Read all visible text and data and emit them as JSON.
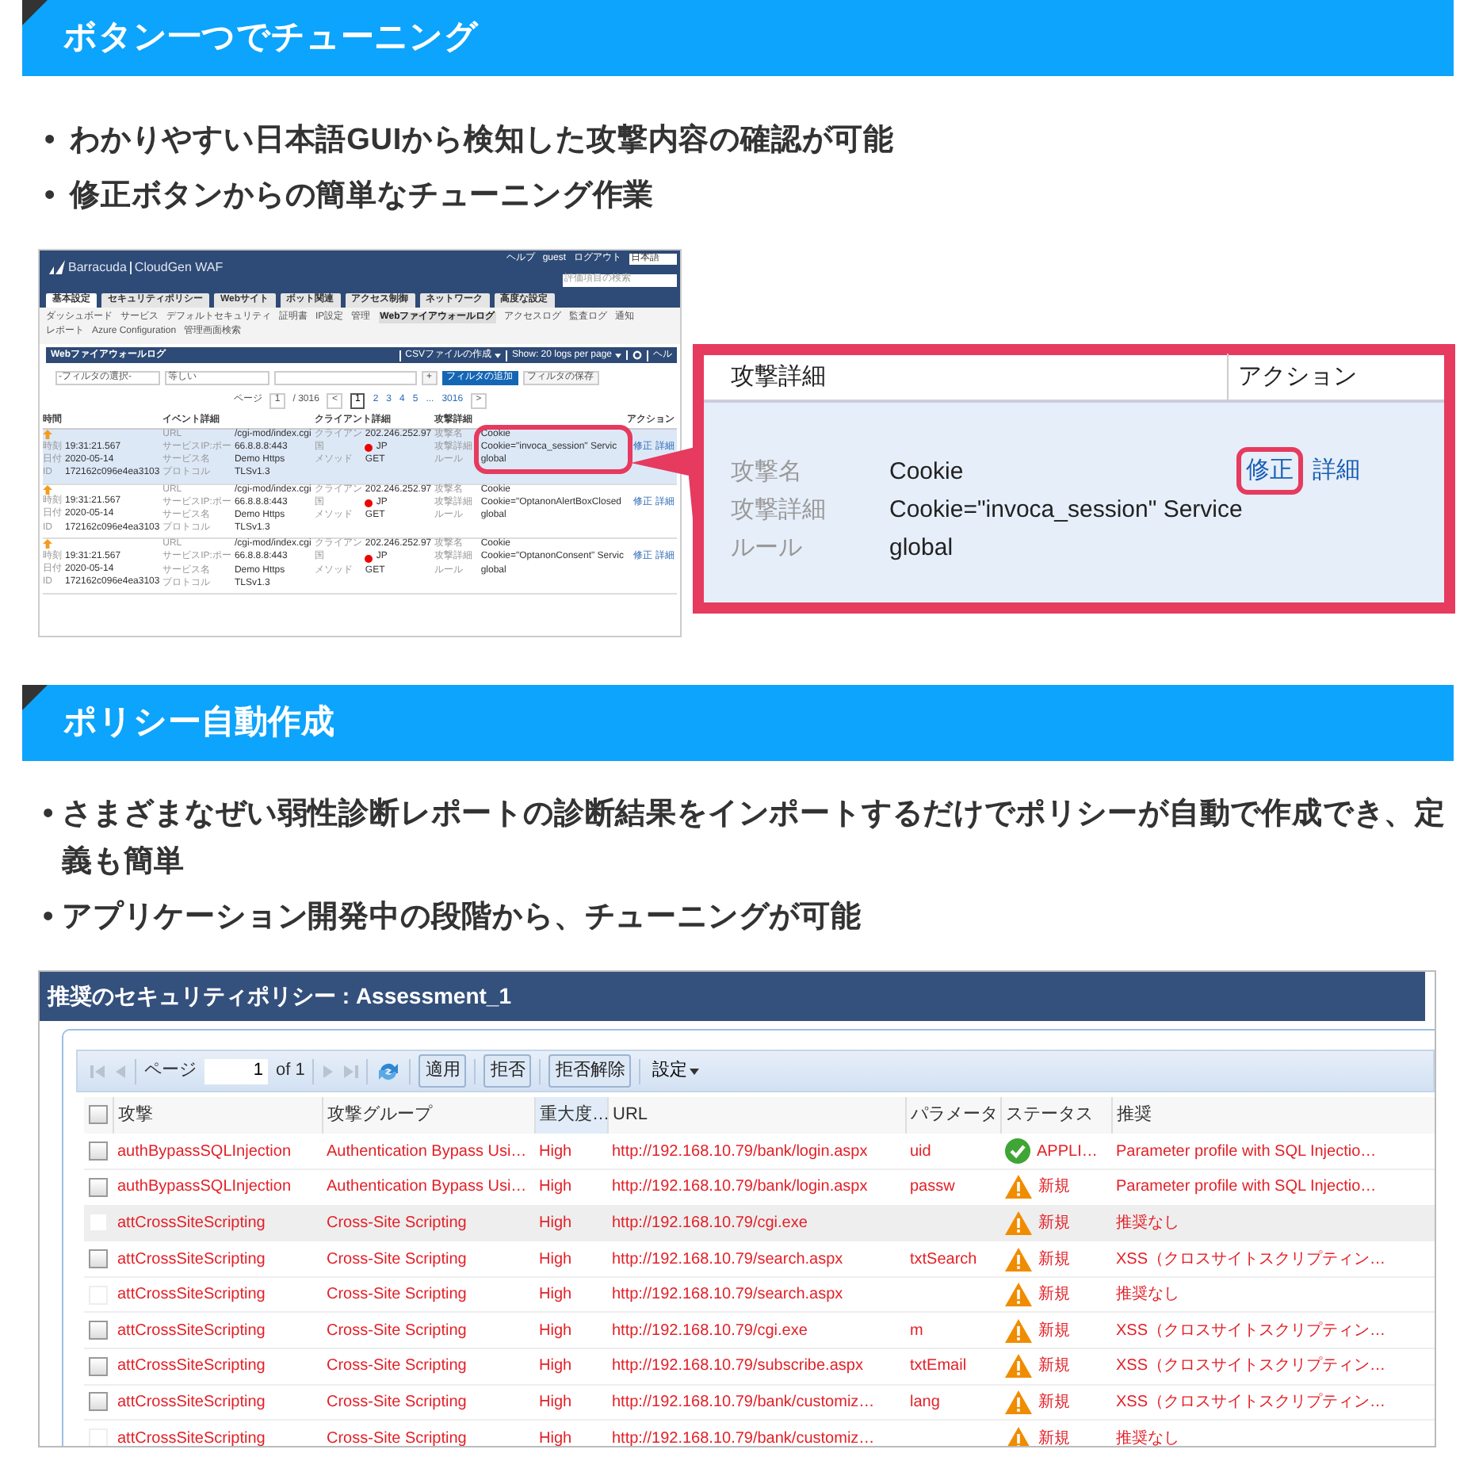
{
  "tuning_section": {
    "title": "ボタン一つでチューニング",
    "bullets": [
      {
        "bullet": "•",
        "text": "わかりやすい日本語GUIから検知した攻撃内容の確認が可能"
      },
      {
        "bullet": "•",
        "text": "修正ボタンからの簡単なチューニング作業"
      }
    ],
    "waf_screenshot": {
      "brand": "Barracuda",
      "product": "CloudGen WAF",
      "help": "ヘルプ",
      "user": "guest",
      "logout": "ログアウト",
      "language": "日本語",
      "search_placeholder": "評価項目の検索",
      "tabs": [
        {
          "label": "基本設定",
          "selected": true
        },
        {
          "label": "セキュリティポリシー",
          "selected": false
        },
        {
          "label": "Webサイト",
          "selected": false
        },
        {
          "label": "ボット関連",
          "selected": false
        },
        {
          "label": "アクセス制御",
          "selected": false
        },
        {
          "label": "ネットワーク",
          "selected": false
        },
        {
          "label": "高度な設定",
          "selected": false
        }
      ],
      "subnav_rows": [
        [
          {
            "label": "ダッシュボード",
            "selected": false
          },
          {
            "label": "サービス",
            "selected": false
          },
          {
            "label": "デフォルトセキュリティ",
            "selected": false
          },
          {
            "label": "証明書",
            "selected": false
          },
          {
            "label": "IP設定",
            "selected": false
          },
          {
            "label": "管理",
            "selected": false
          },
          {
            "label": "Webファイアウォールログ",
            "selected": true
          },
          {
            "label": "アクセスログ",
            "selected": false
          },
          {
            "label": "監査ログ",
            "selected": false
          },
          {
            "label": "通知",
            "selected": false
          }
        ],
        [
          {
            "label": "レポート",
            "selected": false
          },
          {
            "label": "Azure Configuration",
            "selected": false
          },
          {
            "label": "管理画面検索",
            "selected": false
          }
        ]
      ],
      "panel_title": "Webファイアウォールログ",
      "csv_button": "CSVファイルの作成",
      "page_size": "Show: 20 logs per page",
      "help_cut": "ヘル",
      "filter_field": "-フィルタの選択-",
      "operator": "等しい",
      "add_symbol": "+",
      "add_filter": "フィルタの追加",
      "save_filter": "フィルタの保存",
      "pagination": {
        "label": "ページ",
        "page": "1",
        "total": "/ 3016",
        "prev": "<",
        "next": ">",
        "pages": [
          {
            "label": "1",
            "selected": true
          },
          {
            "label": "2",
            "selected": false
          },
          {
            "label": "3",
            "selected": false
          },
          {
            "label": "4",
            "selected": false
          },
          {
            "label": "5",
            "selected": false
          },
          {
            "label": "...",
            "selected": false
          },
          {
            "label": "3016",
            "selected": false
          }
        ]
      },
      "columns": [
        "時間",
        "イベント詳細",
        "クライアント詳細",
        "攻撃詳細",
        "",
        "アクション"
      ],
      "rows": [
        {
          "selected": true,
          "time": [
            {
              "label": "時刻",
              "value": "19:31:21.567"
            },
            {
              "label": "日付",
              "value": "2020-05-14"
            },
            {
              "label": "ID",
              "value": "172162c096e4ea3103"
            }
          ],
          "event": [
            {
              "label": "URL",
              "value": "/cgi-mod/index.cgi"
            },
            {
              "label": "サービスIP:ポー",
              "value": "66.8.8.8:443"
            },
            {
              "label": "サービス名",
              "value": "Demo Https"
            },
            {
              "label": "プロトコル",
              "value": "TLSv1.3"
            }
          ],
          "client": [
            {
              "label": "クライアン",
              "value": "202.246.252.97"
            },
            {
              "label": "国",
              "value": "JP"
            },
            {
              "label": "メソッド",
              "value": "GET"
            }
          ],
          "attack": [
            {
              "label": "攻撃名",
              "value": "Cookie"
            },
            {
              "label": "攻撃詳細",
              "value": "Cookie=\"invoca_session\" Servic"
            },
            {
              "label": "ルール",
              "value": "global"
            }
          ],
          "fix": "修正",
          "details": "詳細"
        },
        {
          "selected": false,
          "time": [
            {
              "label": "時刻",
              "value": "19:31:21.567"
            },
            {
              "label": "日付",
              "value": "2020-05-14"
            },
            {
              "label": "ID",
              "value": "172162c096e4ea3103"
            }
          ],
          "event": [
            {
              "label": "URL",
              "value": "/cgi-mod/index.cgi"
            },
            {
              "label": "サービスIP:ポー",
              "value": "66.8.8.8:443"
            },
            {
              "label": "サービス名",
              "value": "Demo Https"
            },
            {
              "label": "プロトコル",
              "value": "TLSv1.3"
            }
          ],
          "client": [
            {
              "label": "クライアン",
              "value": "202.246.252.97"
            },
            {
              "label": "国",
              "value": "JP"
            },
            {
              "label": "メソッド",
              "value": "GET"
            }
          ],
          "attack": [
            {
              "label": "攻撃名",
              "value": "Cookie"
            },
            {
              "label": "攻撃詳細",
              "value": "Cookie=\"OptanonAlertBoxClosed"
            },
            {
              "label": "ルール",
              "value": "global"
            }
          ],
          "fix": "修正",
          "details": "詳細"
        },
        {
          "selected": false,
          "time": [
            {
              "label": "時刻",
              "value": "19:31:21.567"
            },
            {
              "label": "日付",
              "value": "2020-05-14"
            },
            {
              "label": "ID",
              "value": "172162c096e4ea3103"
            }
          ],
          "event": [
            {
              "label": "URL",
              "value": "/cgi-mod/index.cgi"
            },
            {
              "label": "サービスIP:ポー",
              "value": "66.8.8.8:443"
            },
            {
              "label": "サービス名",
              "value": "Demo Https"
            },
            {
              "label": "プロトコル",
              "value": "TLSv1.3"
            }
          ],
          "client": [
            {
              "label": "クライアン",
              "value": "202.246.252.97"
            },
            {
              "label": "国",
              "value": "JP"
            },
            {
              "label": "メソッド",
              "value": "GET"
            }
          ],
          "attack": [
            {
              "label": "攻撃名",
              "value": "Cookie"
            },
            {
              "label": "攻撃詳細",
              "value": "Cookie=\"OptanonConsent\" Servic"
            },
            {
              "label": "ルール",
              "value": "global"
            }
          ],
          "fix": "修正",
          "details": "詳細"
        }
      ]
    },
    "callout": {
      "columns": [
        "攻撃詳細",
        "アクション"
      ],
      "fields": [
        {
          "label": "攻撃名",
          "value": "Cookie"
        },
        {
          "label": "攻撃詳細",
          "value": "Cookie=\"invoca_session\" Service"
        },
        {
          "label": "ルール",
          "value": "global"
        }
      ],
      "fix": "修正",
      "details": "詳細"
    }
  },
  "policy_section": {
    "title": "ポリシー自動作成",
    "bullets": [
      {
        "bullet": "•",
        "text": "さまざまなぜい弱性診断レポートの診断結果をインポートするだけでポリシーが自動で作成でき、定義も簡単"
      },
      {
        "bullet": "•",
        "text": "アプリケーション開発中の段階から、チューニングが可能"
      }
    ],
    "policy_screenshot": {
      "title": "推奨のセキュリティポリシー : Assessment_1",
      "select_all_checked": false,
      "toolbar": {
        "page_label": "ページ",
        "page": "1",
        "of": "of 1",
        "buttons": [
          "適用",
          "拒否",
          "拒否解除"
        ],
        "settings": "設定"
      },
      "columns": [
        {
          "label": "攻撃",
          "sorted": false
        },
        {
          "label": "攻撃グループ",
          "sorted": false
        },
        {
          "label": "重大度…",
          "sorted": true
        },
        {
          "label": "URL",
          "sorted": false
        },
        {
          "label": "パラメータ",
          "sorted": false
        },
        {
          "label": "ステータス",
          "sorted": false
        },
        {
          "label": "推奨",
          "sorted": false
        }
      ],
      "rows": [
        {
          "selected": false,
          "disabled": false,
          "attack": "authBypassSQLInjection",
          "group": "Authentication Bypass Usi…",
          "severity": "High",
          "url": "http://192.168.10.79/bank/login.aspx",
          "parameter": "uid",
          "kind": "applied",
          "status": "APPLI…",
          "recommendation": "Parameter profile with SQL Injectio…"
        },
        {
          "selected": false,
          "disabled": false,
          "attack": "authBypassSQLInjection",
          "group": "Authentication Bypass Usi…",
          "severity": "High",
          "url": "http://192.168.10.79/bank/login.aspx",
          "parameter": "passw",
          "kind": "new",
          "status": "新規",
          "recommendation": "Parameter profile with SQL Injectio…"
        },
        {
          "selected": true,
          "disabled": true,
          "attack": "attCrossSiteScripting",
          "group": "Cross-Site Scripting",
          "severity": "High",
          "url": "http://192.168.10.79/cgi.exe",
          "kind": "new",
          "status": "新規",
          "recommendation": "推奨なし"
        },
        {
          "selected": false,
          "disabled": false,
          "attack": "attCrossSiteScripting",
          "group": "Cross-Site Scripting",
          "severity": "High",
          "url": "http://192.168.10.79/search.aspx",
          "parameter": "txtSearch",
          "kind": "new",
          "status": "新規",
          "recommendation": "XSS（クロスサイトスクリプティン…"
        },
        {
          "selected": false,
          "disabled": true,
          "attack": "attCrossSiteScripting",
          "group": "Cross-Site Scripting",
          "severity": "High",
          "url": "http://192.168.10.79/search.aspx",
          "kind": "new",
          "status": "新規",
          "recommendation": "推奨なし"
        },
        {
          "selected": false,
          "disabled": false,
          "attack": "attCrossSiteScripting",
          "group": "Cross-Site Scripting",
          "severity": "High",
          "url": "http://192.168.10.79/cgi.exe",
          "parameter": "m",
          "kind": "new",
          "status": "新規",
          "recommendation": "XSS（クロスサイトスクリプティン…"
        },
        {
          "selected": false,
          "disabled": false,
          "attack": "attCrossSiteScripting",
          "group": "Cross-Site Scripting",
          "severity": "High",
          "url": "http://192.168.10.79/subscribe.aspx",
          "parameter": "txtEmail",
          "kind": "new",
          "status": "新規",
          "recommendation": "XSS（クロスサイトスクリプティン…"
        },
        {
          "selected": false,
          "disabled": false,
          "attack": "attCrossSiteScripting",
          "group": "Cross-Site Scripting",
          "severity": "High",
          "url": "http://192.168.10.79/bank/customiz…",
          "parameter": "lang",
          "kind": "new",
          "status": "新規",
          "recommendation": "XSS（クロスサイトスクリプティン…"
        },
        {
          "selected": false,
          "disabled": true,
          "attack": "attCrossSiteScripting",
          "group": "Cross-Site Scripting",
          "severity": "High",
          "url": "http://192.168.10.79/bank/customiz…",
          "kind": "new",
          "status": "新規",
          "recommendation": "推奨なし"
        }
      ]
    }
  }
}
